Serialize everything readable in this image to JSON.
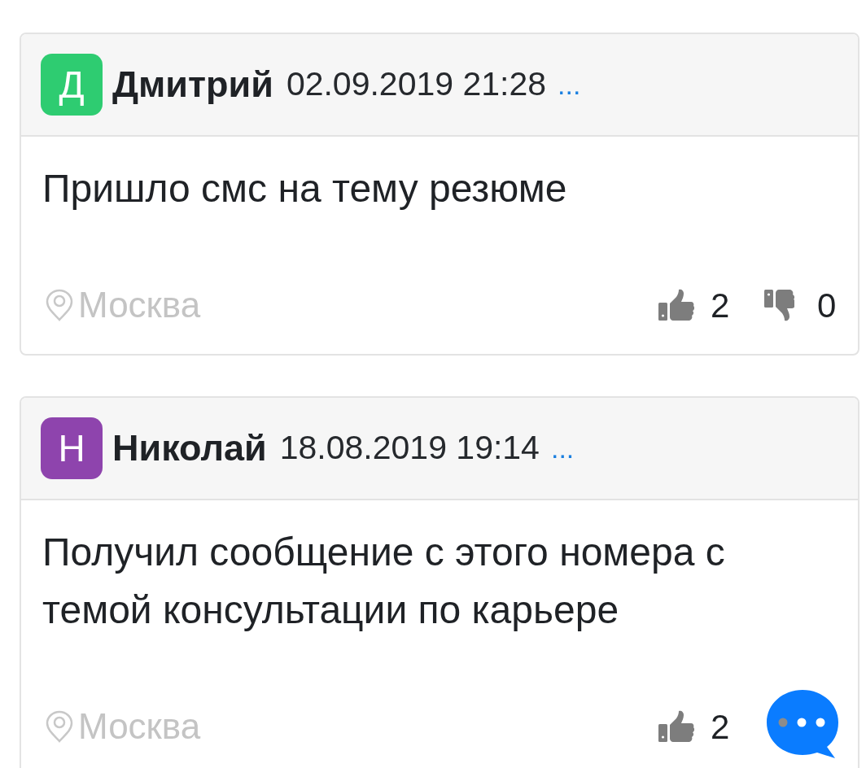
{
  "comments": [
    {
      "avatar": {
        "letter": "Д",
        "color": "#2ecc71"
      },
      "author": "Дмитрий",
      "date": "02.09.2019 21:28",
      "menu": "...",
      "text": "Пришло смс на тему резюме",
      "location": "Москва",
      "likes": "2",
      "dislikes": "0"
    },
    {
      "avatar": {
        "letter": "Н",
        "color": "#8e44ad"
      },
      "author": "Николай",
      "date": "18.08.2019 19:14",
      "menu": "...",
      "text": "Получил сообщение с этого номера с темой консультации по карьере",
      "location": "Москва",
      "likes": "2"
    }
  ]
}
